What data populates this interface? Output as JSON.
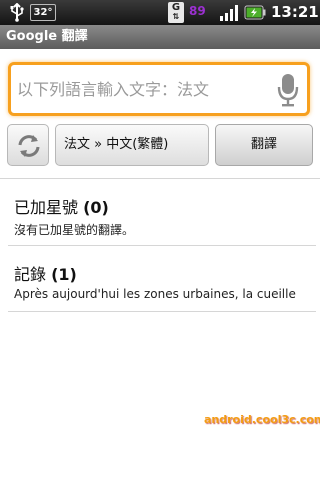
{
  "status_bar": {
    "usb_icon": "usb-icon",
    "temperature": "32°",
    "g_indicator": "G",
    "percent_partial": "89",
    "time": "13:21"
  },
  "app": {
    "title": "Google 翻譯"
  },
  "input": {
    "placeholder": "以下列語言輸入文字：法文",
    "value": "",
    "icon": "microphone-icon"
  },
  "controls": {
    "swap_icon": "swap-languages-icon",
    "language_pair": "法文 » 中文(繁體)",
    "translate_label": "翻譯"
  },
  "starred": {
    "title": "已加星號",
    "count": "(0)",
    "subtitle": "沒有已加星號的翻譯。"
  },
  "history": {
    "title": "記錄",
    "count": "(1)",
    "entry": "Après aujourd'hui les zones urbaines, la cueille"
  },
  "watermark": "android.cool3c.com",
  "colors": {
    "accent": "#f7a01e",
    "titlebar": "#6f6f6f",
    "statusbar": "#1e1e1e"
  }
}
